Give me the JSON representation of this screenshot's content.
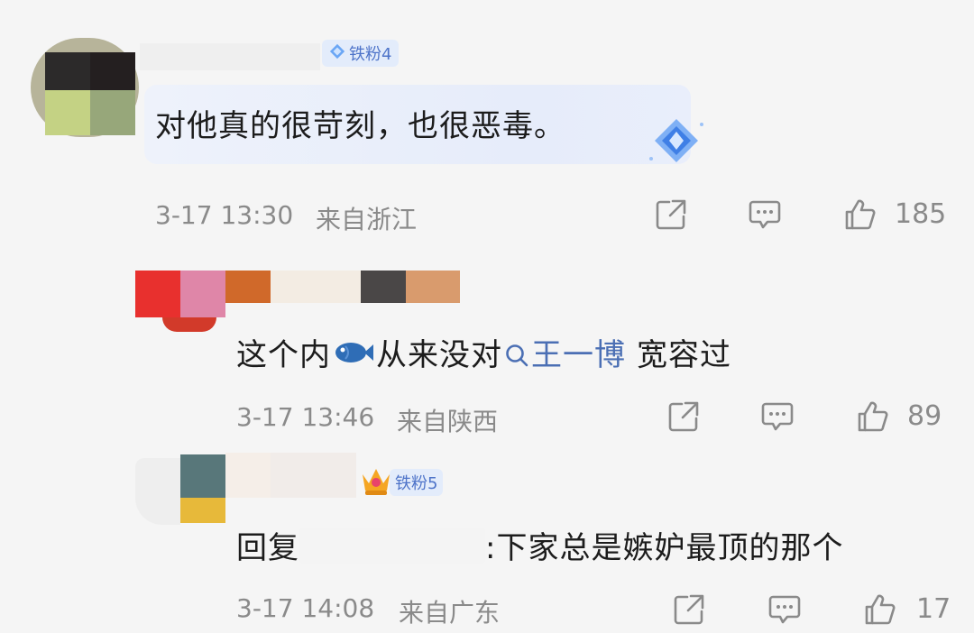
{
  "comments": [
    {
      "badge": "铁粉4",
      "text": "对他真的很苛刻，也很恶毒。",
      "time": "3-17 13:30",
      "location": "来自浙江",
      "likes": "185"
    },
    {
      "badge": "",
      "text_before": "这个内",
      "fish": "🐟",
      "text_after": "从来没对",
      "mention": "王一博",
      "text_tail": "宽容过",
      "time": "3-17 13:46",
      "location": "来自陕西",
      "likes": "89"
    },
    {
      "badge": "铁粉5",
      "reply_prefix": "回复",
      "text": ":下家总是嫉妒最顶的那个",
      "time": "3-17 14:08",
      "location": "来自广东",
      "likes": "17"
    }
  ],
  "colors": {
    "badge_blue": "#4e74c9",
    "mention_blue": "#4b6fb4",
    "meta_gray": "#8a8a8a"
  },
  "icons": [
    "share-icon",
    "comment-icon",
    "like-icon",
    "search-icon",
    "diamond-icon",
    "crown-icon",
    "fish-emoji"
  ]
}
